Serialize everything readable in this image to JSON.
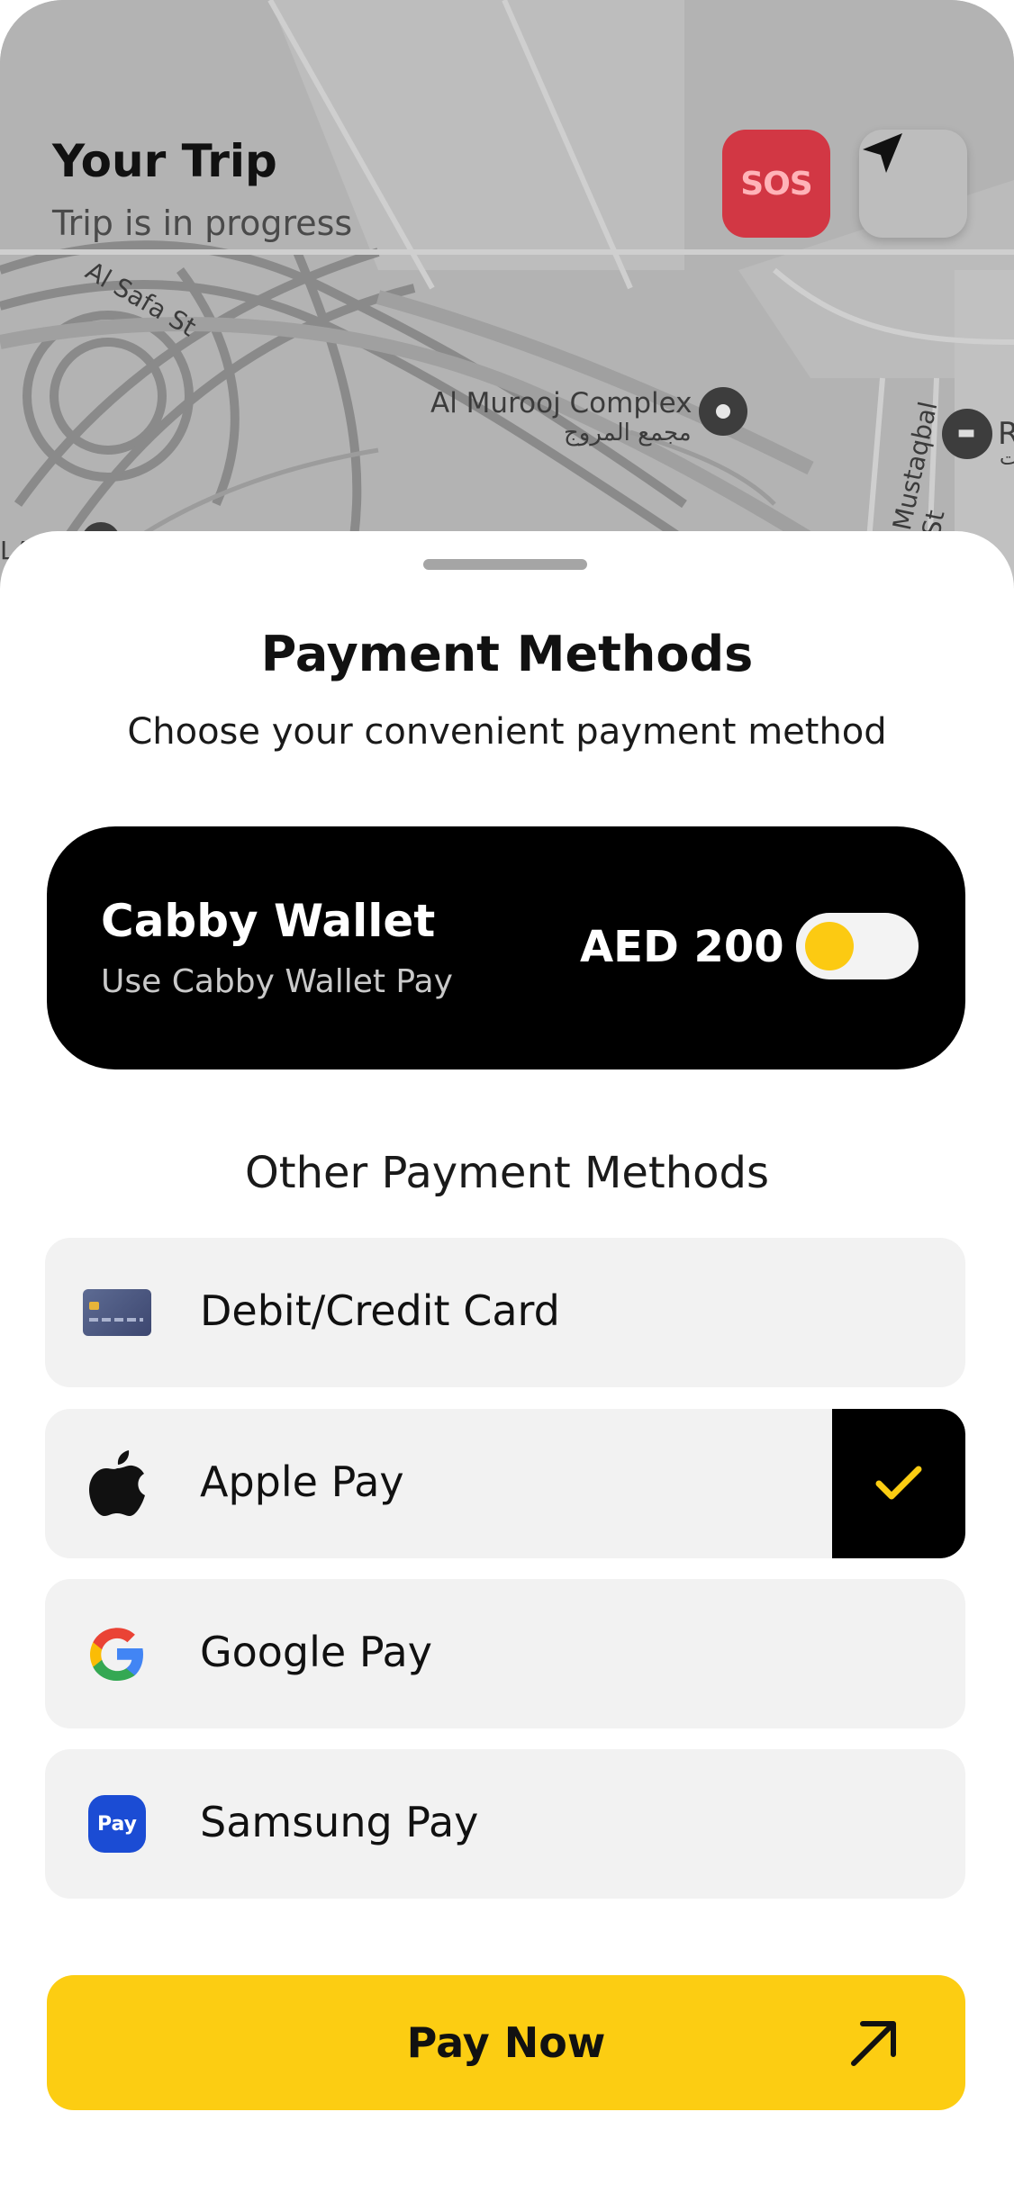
{
  "header": {
    "title": "Your Trip",
    "status": "Trip is in progress",
    "sos_label": "SOS"
  },
  "map": {
    "labels": {
      "complex": "Al Murooj Complex",
      "complex_ar": "مجمع المروج",
      "street_safa": "Al Safa St",
      "street_mustaqbal": "Mustaqbal St",
      "edge_poi": "R",
      "edge_poi_sub": "ت",
      "left_edge": "LA"
    }
  },
  "sheet": {
    "title": "Payment Methods",
    "subtitle": "Choose your convenient payment method"
  },
  "wallet": {
    "title": "Cabby Wallet",
    "subtitle": "Use Cabby Wallet Pay",
    "balance": "AED 200",
    "enabled": true
  },
  "other": {
    "title": "Other Payment Methods",
    "methods": [
      {
        "label": "Debit/Credit Card",
        "icon": "credit-card-icon",
        "selected": false
      },
      {
        "label": "Apple Pay",
        "icon": "apple-icon",
        "selected": true
      },
      {
        "label": "Google Pay",
        "icon": "google-icon",
        "selected": false
      },
      {
        "label": "Samsung Pay",
        "icon": "samsung-pay-icon",
        "icon_text": "Pay",
        "selected": false
      }
    ]
  },
  "actions": {
    "pay_label": "Pay Now"
  },
  "colors": {
    "accent": "#fccd12",
    "sos": "#d23744",
    "wallet_bg": "#000000",
    "method_bg": "#f2f2f2"
  }
}
